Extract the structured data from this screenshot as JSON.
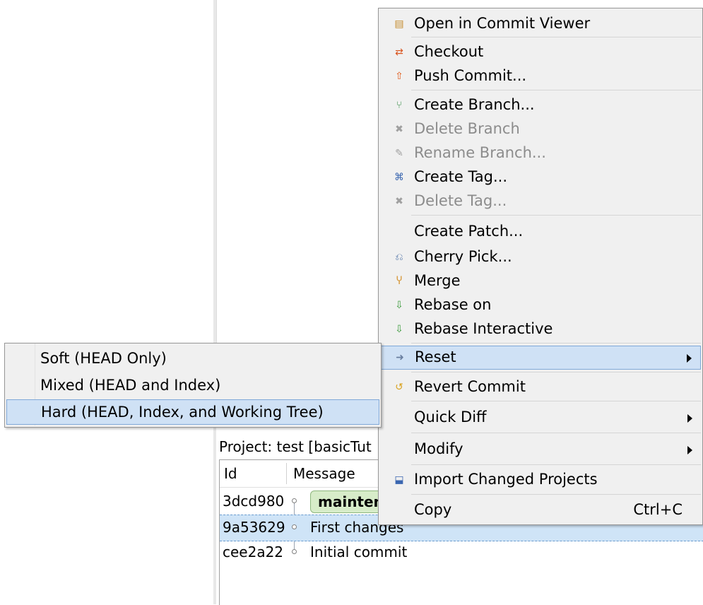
{
  "history": {
    "project_label": "Project: test [basicTut",
    "columns": {
      "id": "Id",
      "message": "Message"
    },
    "rows": [
      {
        "id": "3dcd980",
        "message": "",
        "branch": "mainten"
      },
      {
        "id": "9a53629",
        "message": "First changes"
      },
      {
        "id": "cee2a22",
        "message": "Initial commit"
      }
    ]
  },
  "context_menu": {
    "items": [
      {
        "label": "Open in Commit Viewer",
        "icon": "commit-viewer-icon",
        "glyph": "▤"
      },
      {
        "label": "Checkout",
        "icon": "checkout-icon",
        "glyph": "⇄"
      },
      {
        "label": "Push Commit...",
        "icon": "push-icon",
        "glyph": "⇧"
      },
      {
        "label": "Create Branch...",
        "icon": "create-branch-icon",
        "glyph": "⑂"
      },
      {
        "label": "Delete Branch",
        "icon": "delete-branch-icon",
        "glyph": "✖"
      },
      {
        "label": "Rename Branch...",
        "icon": "rename-branch-icon",
        "glyph": "✎"
      },
      {
        "label": "Create Tag...",
        "icon": "create-tag-icon",
        "glyph": "⌘"
      },
      {
        "label": "Delete Tag...",
        "icon": "delete-tag-icon",
        "glyph": "✖"
      },
      {
        "label": "Create Patch..."
      },
      {
        "label": "Cherry Pick...",
        "icon": "cherry-pick-icon",
        "glyph": "⎌"
      },
      {
        "label": "Merge",
        "icon": "merge-icon",
        "glyph": "Ⴤ"
      },
      {
        "label": "Rebase on",
        "icon": "rebase-icon",
        "glyph": "⇩"
      },
      {
        "label": "Rebase Interactive",
        "icon": "rebase-interactive-icon",
        "glyph": "⇩"
      },
      {
        "label": "Reset",
        "icon": "reset-icon",
        "glyph": "➜"
      },
      {
        "label": "Revert Commit",
        "icon": "revert-icon",
        "glyph": "↺"
      },
      {
        "label": "Quick Diff"
      },
      {
        "label": "Modify"
      },
      {
        "label": "Import Changed Projects",
        "icon": "import-icon",
        "glyph": "⬓"
      },
      {
        "label": "Copy",
        "shortcut": "Ctrl+C"
      }
    ]
  },
  "reset_submenu": {
    "items": [
      {
        "label": "Soft (HEAD Only)"
      },
      {
        "label": "Mixed (HEAD and Index)"
      },
      {
        "label": "Hard (HEAD, Index, and Working Tree)"
      }
    ]
  },
  "colors": {
    "menu_bg": "#f0f0f0",
    "highlight_bg": "#cfe1f5",
    "highlight_border": "#80a8d8",
    "disabled_text": "#8c8c8c",
    "selected_row": "#cfe4f7",
    "branch_badge": "#d7ecc9"
  }
}
